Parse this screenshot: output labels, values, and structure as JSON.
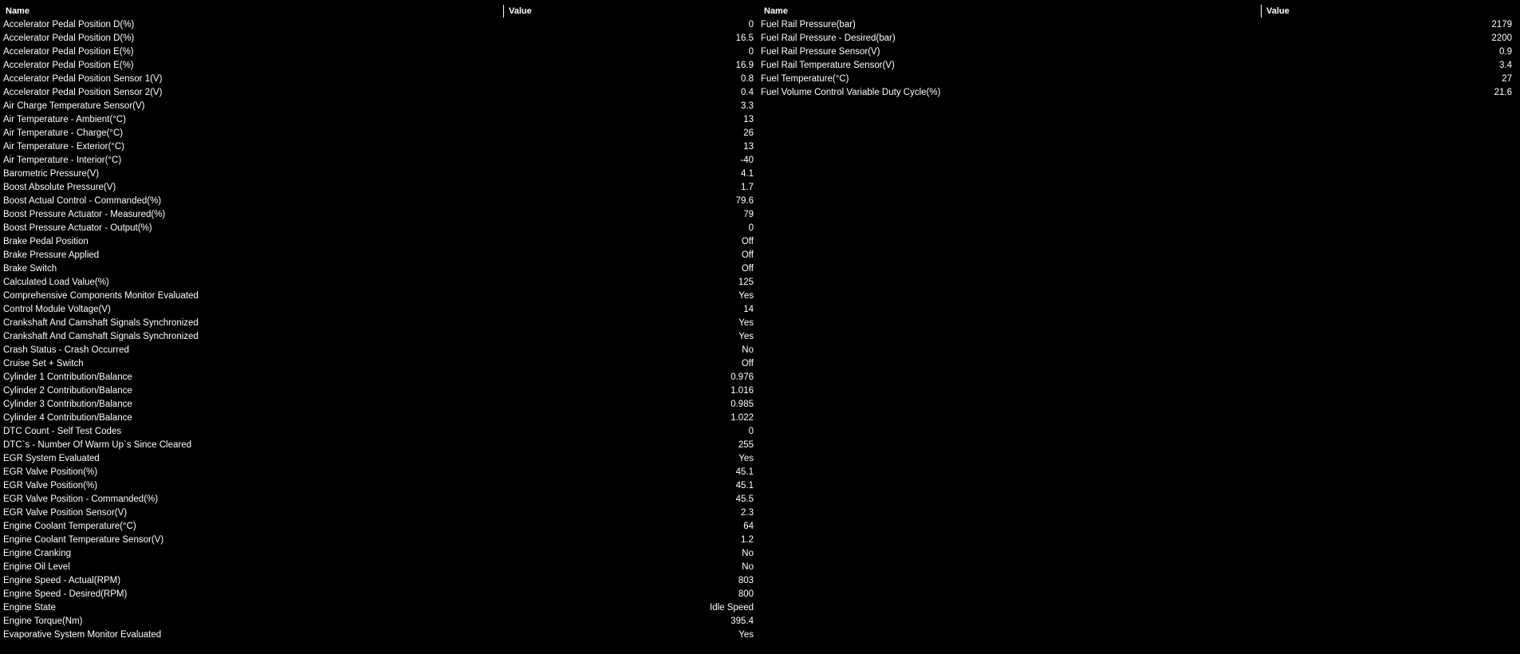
{
  "left_panel": {
    "header": {
      "name": "Name",
      "value": "Value"
    },
    "rows": [
      {
        "name": "Accelerator Pedal Position D(%)",
        "value": "0"
      },
      {
        "name": "Accelerator Pedal Position D(%)",
        "value": "16.5"
      },
      {
        "name": "Accelerator Pedal Position E(%)",
        "value": "0"
      },
      {
        "name": "Accelerator Pedal Position E(%)",
        "value": "16.9"
      },
      {
        "name": "Accelerator Pedal Position Sensor 1(V)",
        "value": "0.8"
      },
      {
        "name": "Accelerator Pedal Position Sensor 2(V)",
        "value": "0.4"
      },
      {
        "name": "Air Charge Temperature Sensor(V)",
        "value": "3.3"
      },
      {
        "name": "Air Temperature - Ambient(°C)",
        "value": "13"
      },
      {
        "name": "Air Temperature - Charge(°C)",
        "value": "26"
      },
      {
        "name": "Air Temperature - Exterior(°C)",
        "value": "13"
      },
      {
        "name": "Air Temperature - Interior(°C)",
        "value": "-40"
      },
      {
        "name": "Barometric Pressure(V)",
        "value": "4.1"
      },
      {
        "name": "Boost Absolute Pressure(V)",
        "value": "1.7"
      },
      {
        "name": "Boost Actual Control - Commanded(%)",
        "value": "79.6"
      },
      {
        "name": "Boost Pressure Actuator - Measured(%)",
        "value": "79"
      },
      {
        "name": "Boost Pressure Actuator - Output(%)",
        "value": "0"
      },
      {
        "name": "Brake Pedal Position",
        "value": "Off"
      },
      {
        "name": "Brake Pressure Applied",
        "value": "Off"
      },
      {
        "name": "Brake Switch",
        "value": "Off"
      },
      {
        "name": "Calculated Load Value(%)",
        "value": "125"
      },
      {
        "name": "Comprehensive Components Monitor Evaluated",
        "value": "Yes"
      },
      {
        "name": "Control Module Voltage(V)",
        "value": "14"
      },
      {
        "name": "Crankshaft And Camshaft Signals Synchronized",
        "value": "Yes"
      },
      {
        "name": "Crankshaft And Camshaft Signals Synchronized",
        "value": "Yes"
      },
      {
        "name": "Crash Status - Crash Occurred",
        "value": "No"
      },
      {
        "name": "Cruise Set + Switch",
        "value": "Off"
      },
      {
        "name": "Cylinder 1 Contribution/Balance",
        "value": "0.976"
      },
      {
        "name": "Cylinder 2 Contribution/Balance",
        "value": "1.016"
      },
      {
        "name": "Cylinder 3 Contribution/Balance",
        "value": "0.985"
      },
      {
        "name": "Cylinder 4 Contribution/Balance",
        "value": "1.022"
      },
      {
        "name": "DTC Count - Self Test Codes",
        "value": "0"
      },
      {
        "name": "DTC`s - Number Of Warm Up`s Since Cleared",
        "value": "255"
      },
      {
        "name": "EGR System Evaluated",
        "value": "Yes"
      },
      {
        "name": "EGR Valve Position(%)",
        "value": "45.1"
      },
      {
        "name": "EGR Valve Position(%)",
        "value": "45.1"
      },
      {
        "name": "EGR Valve Position - Commanded(%)",
        "value": "45.5"
      },
      {
        "name": "EGR Valve Position Sensor(V)",
        "value": "2.3"
      },
      {
        "name": "Engine Coolant Temperature(°C)",
        "value": "64"
      },
      {
        "name": "Engine Coolant Temperature Sensor(V)",
        "value": "1.2"
      },
      {
        "name": "Engine Cranking",
        "value": "No"
      },
      {
        "name": "Engine Oil Level",
        "value": "No"
      },
      {
        "name": "Engine Speed - Actual(RPM)",
        "value": "803"
      },
      {
        "name": "Engine Speed - Desired(RPM)",
        "value": "800"
      },
      {
        "name": "Engine State",
        "value": "Idle Speed"
      },
      {
        "name": "Engine Torque(Nm)",
        "value": "395.4"
      },
      {
        "name": "Evaporative System Monitor Evaluated",
        "value": "Yes"
      }
    ]
  },
  "right_panel": {
    "header": {
      "name": "Name",
      "value": "Value"
    },
    "rows": [
      {
        "name": "Fuel Rail Pressure(bar)",
        "value": "2179"
      },
      {
        "name": "Fuel Rail Pressure - Desired(bar)",
        "value": "2200"
      },
      {
        "name": "Fuel Rail Pressure Sensor(V)",
        "value": "0.9"
      },
      {
        "name": "Fuel Rail Temperature Sensor(V)",
        "value": "3.4"
      },
      {
        "name": "Fuel Temperature(°C)",
        "value": "27"
      },
      {
        "name": "Fuel Volume Control Variable Duty Cycle(%)",
        "value": "21.6"
      }
    ]
  }
}
